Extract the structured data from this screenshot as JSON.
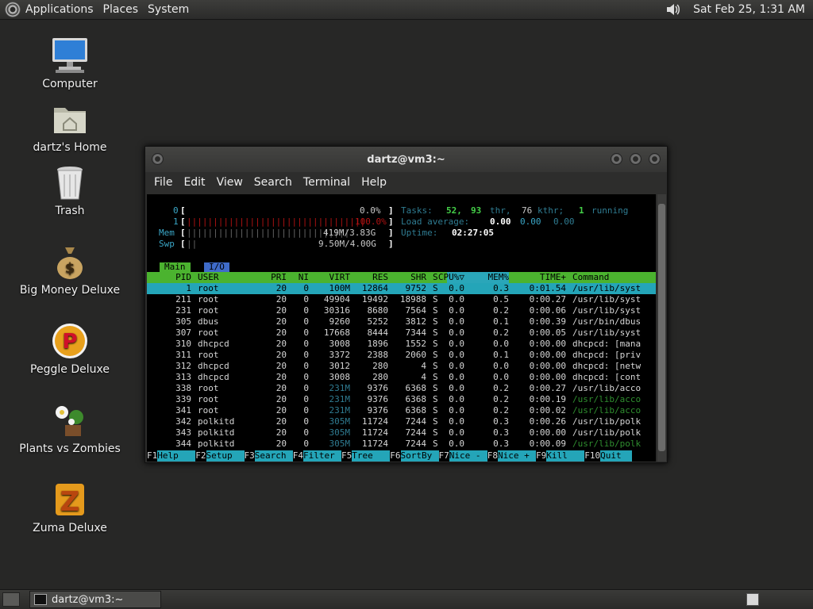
{
  "top_panel": {
    "menus": [
      "Applications",
      "Places",
      "System"
    ],
    "clock": "Sat Feb 25,  1:31 AM"
  },
  "desktop_icons": [
    {
      "label": "Computer",
      "icon": "computer-icon"
    },
    {
      "label": "dartz's Home",
      "icon": "home-folder-icon"
    },
    {
      "label": "Trash",
      "icon": "trash-icon"
    },
    {
      "label": "Big Money Deluxe",
      "icon": "money-bag-icon"
    },
    {
      "label": "Peggle Deluxe",
      "icon": "peggle-icon"
    },
    {
      "label": "Plants vs Zombies",
      "icon": "plants-zombies-icon"
    },
    {
      "label": "Zuma Deluxe",
      "icon": "zuma-icon"
    }
  ],
  "terminal": {
    "title": "dartz@vm3:~",
    "menus": [
      "File",
      "Edit",
      "View",
      "Search",
      "Terminal",
      "Help"
    ],
    "meters": {
      "cpu0": {
        "label": "0",
        "value": "0.0%"
      },
      "cpu1": {
        "label": "1",
        "value": "100.0%"
      },
      "mem": {
        "label": "Mem",
        "value": "419M/3.83G"
      },
      "swp": {
        "label": "Swp",
        "value": "9.50M/4.00G"
      }
    },
    "tasks": {
      "label": "Tasks:",
      "count": "52,",
      "thr": "93",
      "thr_label": "thr,",
      "kthr": "76",
      "kthr_label": "kthr;",
      "running": "1",
      "running_label": "running"
    },
    "load": {
      "label": "Load average:",
      "v1": "0.00",
      "v2": "0.00",
      "v3": "0.00"
    },
    "uptime": {
      "label": "Uptime:",
      "value": "02:27:05"
    },
    "tabs": [
      "Main",
      "I/O"
    ],
    "columns": [
      "PID",
      "USER",
      "PRI",
      "NI",
      "VIRT",
      "RES",
      "SHR",
      "S",
      "CPU%▽",
      "MEM%",
      "TIME+",
      "Command"
    ],
    "processes": [
      [
        "1",
        "root",
        "20",
        "0",
        "100M",
        "12864",
        "9752",
        "S",
        "0.0",
        "0.3",
        "0:01.54",
        "/usr/lib/syst"
      ],
      [
        "211",
        "root",
        "20",
        "0",
        "49904",
        "19492",
        "18988",
        "S",
        "0.0",
        "0.5",
        "0:00.27",
        "/usr/lib/syst"
      ],
      [
        "231",
        "root",
        "20",
        "0",
        "30316",
        "8680",
        "7564",
        "S",
        "0.0",
        "0.2",
        "0:00.06",
        "/usr/lib/syst"
      ],
      [
        "305",
        "dbus",
        "20",
        "0",
        "9260",
        "5252",
        "3812",
        "S",
        "0.0",
        "0.1",
        "0:00.39",
        "/usr/bin/dbus"
      ],
      [
        "307",
        "root",
        "20",
        "0",
        "17668",
        "8444",
        "7344",
        "S",
        "0.0",
        "0.2",
        "0:00.05",
        "/usr/lib/syst"
      ],
      [
        "310",
        "dhcpcd",
        "20",
        "0",
        "3008",
        "1896",
        "1552",
        "S",
        "0.0",
        "0.0",
        "0:00.00",
        "dhcpcd: [mana"
      ],
      [
        "311",
        "root",
        "20",
        "0",
        "3372",
        "2388",
        "2060",
        "S",
        "0.0",
        "0.1",
        "0:00.00",
        "dhcpcd: [priv"
      ],
      [
        "312",
        "dhcpcd",
        "20",
        "0",
        "3012",
        "280",
        "4",
        "S",
        "0.0",
        "0.0",
        "0:00.00",
        "dhcpcd: [netw"
      ],
      [
        "313",
        "dhcpcd",
        "20",
        "0",
        "3008",
        "280",
        "4",
        "S",
        "0.0",
        "0.0",
        "0:00.00",
        "dhcpcd: [cont"
      ],
      [
        "338",
        "root",
        "20",
        "0",
        "231M",
        "9376",
        "6368",
        "S",
        "0.0",
        "0.2",
        "0:00.27",
        "/usr/lib/acco"
      ],
      [
        "339",
        "root",
        "20",
        "0",
        "231M",
        "9376",
        "6368",
        "S",
        "0.0",
        "0.2",
        "0:00.19",
        "/usr/lib/acco"
      ],
      [
        "341",
        "root",
        "20",
        "0",
        "231M",
        "9376",
        "6368",
        "S",
        "0.0",
        "0.2",
        "0:00.02",
        "/usr/lib/acco"
      ],
      [
        "342",
        "polkitd",
        "20",
        "0",
        "305M",
        "11724",
        "7244",
        "S",
        "0.0",
        "0.3",
        "0:00.26",
        "/usr/lib/polk"
      ],
      [
        "343",
        "polkitd",
        "20",
        "0",
        "305M",
        "11724",
        "7244",
        "S",
        "0.0",
        "0.3",
        "0:00.00",
        "/usr/lib/polk"
      ],
      [
        "344",
        "polkitd",
        "20",
        "0",
        "305M",
        "11724",
        "7244",
        "S",
        "0.0",
        "0.3",
        "0:00.09",
        "/usr/lib/polk"
      ]
    ],
    "fkeys": [
      {
        "key": "F1",
        "label": "Help"
      },
      {
        "key": "F2",
        "label": "Setup"
      },
      {
        "key": "F3",
        "label": "Search"
      },
      {
        "key": "F4",
        "label": "Filter"
      },
      {
        "key": "F5",
        "label": "Tree"
      },
      {
        "key": "F6",
        "label": "SortBy"
      },
      {
        "key": "F7",
        "label": "Nice -"
      },
      {
        "key": "F8",
        "label": "Nice +"
      },
      {
        "key": "F9",
        "label": "Kill"
      },
      {
        "key": "F10",
        "label": "Quit"
      }
    ]
  },
  "taskbar": {
    "window_label": "dartz@vm3:~"
  }
}
